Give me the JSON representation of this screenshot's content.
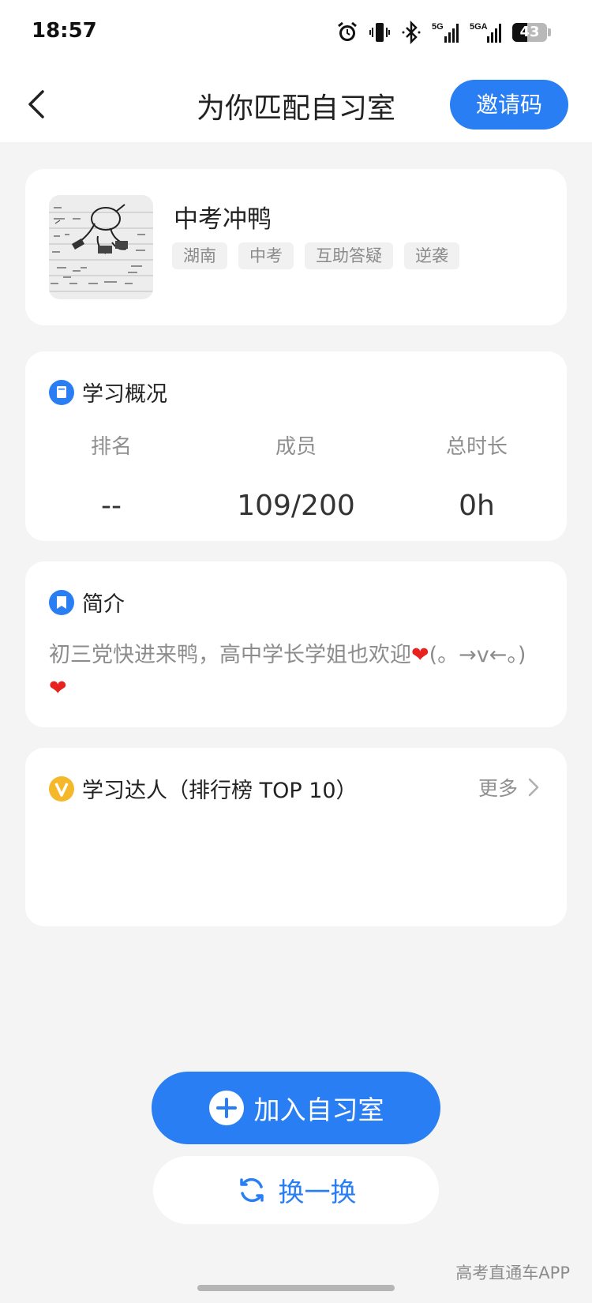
{
  "status_bar": {
    "time": "18:57",
    "battery": "43",
    "battery_level": 0.43,
    "icons": [
      "alarm-icon",
      "vibrate-icon",
      "bluetooth-icon",
      "signal-5g-icon",
      "signal-5ga-icon",
      "battery-icon"
    ],
    "signal_labels": [
      "5G",
      "5GA"
    ]
  },
  "nav": {
    "title": "为你匹配自习室",
    "invite_label": "邀请码",
    "back_icon": "chevron-left-icon"
  },
  "room": {
    "name": "中考冲鸭",
    "tags": [
      "湖南",
      "中考",
      "互助答疑",
      "逆袭"
    ]
  },
  "overview": {
    "title": "学习概况",
    "icon": "book-icon",
    "stats": [
      {
        "label": "排名",
        "value": "--"
      },
      {
        "label": "成员",
        "value": "109/200"
      },
      {
        "label": "总时长",
        "value": "0h"
      }
    ]
  },
  "intro": {
    "title": "简介",
    "icon": "bookmark-icon",
    "text_before_heart": "初三党快进来鸭，高中学长学姐也欢迎",
    "heart": "❤",
    "text_after_heart": "(。→v←。)",
    "heart_color": "#e8231f"
  },
  "top_list": {
    "title": "学习达人（排行榜 TOP 10）",
    "icon": "v-badge-icon",
    "more_label": "更多"
  },
  "actions": {
    "join_label": "加入自习室",
    "switch_label": "换一换"
  },
  "watermark": "高考直通车APP",
  "colors": {
    "accent": "#2a7ef4",
    "background": "#f4f4f4",
    "badge_yellow": "#f6b82b"
  }
}
